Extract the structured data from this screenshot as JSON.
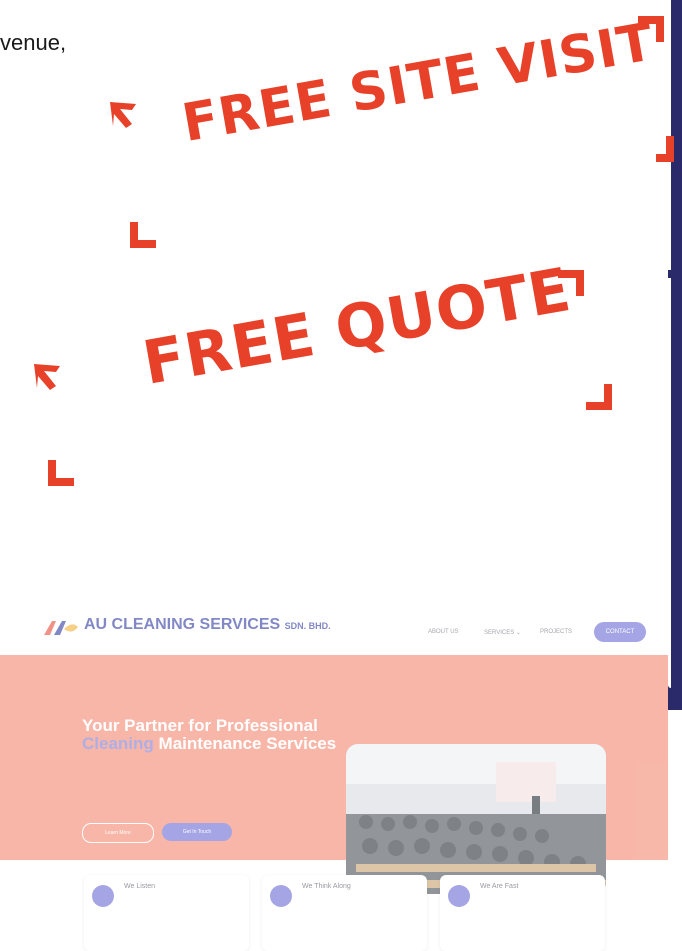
{
  "address_fragment": "venue,",
  "stamps": {
    "line1": "FREE SITE VISIT",
    "line2": "FREE QUOTE"
  },
  "colors": {
    "stamp_red": "#e8412a",
    "brand_blue": "#2f3aa0",
    "accent_purple": "#6b6bd4",
    "hero_coral": "#f2876f",
    "side_panel": "#2a2a6a"
  },
  "website": {
    "brand_name": "AU CLEANING SERVICES",
    "brand_suffix": "SDN. BHD.",
    "logo_icon": "au-logo-icon",
    "nav": {
      "about": "ABOUT US",
      "services": "SERVICES ⌄",
      "projects": "PROJECTS",
      "contact": "CONTACT"
    },
    "hero": {
      "title_part1": "Your Partner for Professional",
      "title_highlight": "Cleaning",
      "title_part2": "Maintenance Services",
      "btn_learn": "Learn More",
      "btn_touch": "Get In Touch"
    },
    "cards": [
      {
        "title": "We Listen",
        "icon": "ear-icon"
      },
      {
        "title": "We Think Along",
        "icon": "thought-icon"
      },
      {
        "title": "We Are Fast",
        "icon": "lightning-icon"
      }
    ]
  }
}
